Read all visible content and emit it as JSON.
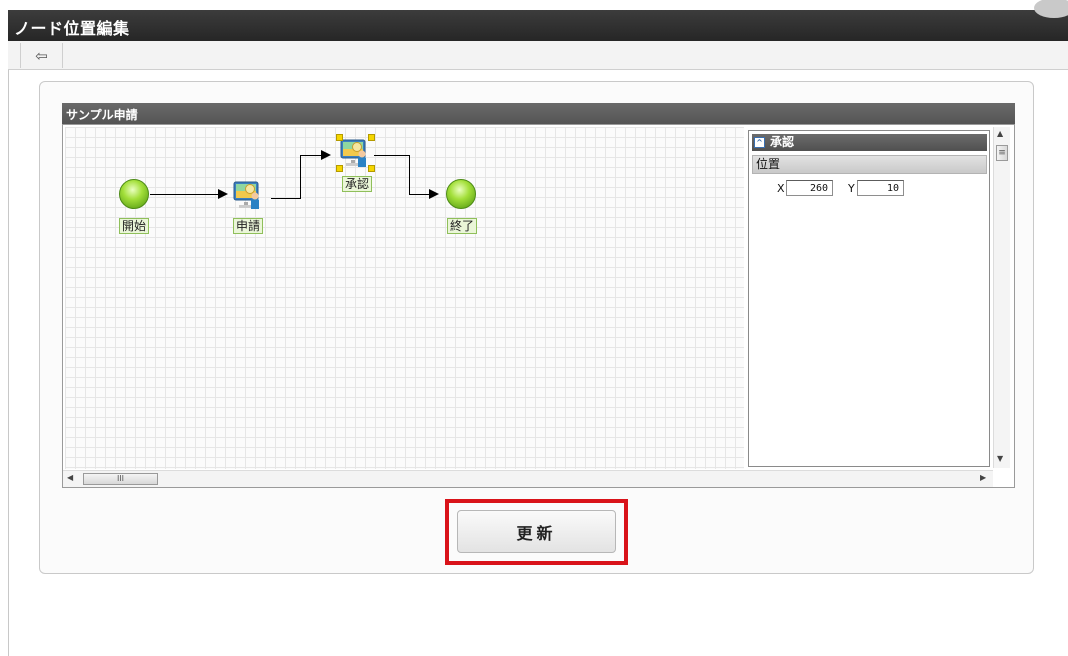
{
  "window": {
    "title": "ノード位置編集"
  },
  "toolbar": {
    "back_icon": "back-arrow-icon",
    "back_glyph": "⇦"
  },
  "flow": {
    "name": "サンプル申請",
    "nodes": {
      "start": "開始",
      "apply": "申請",
      "approve": "承認",
      "end": "終了"
    }
  },
  "properties": {
    "node_title": "承認",
    "collapse_glyph": "^",
    "section": "位置",
    "x_label": "X",
    "x_value": "260",
    "y_label": "Y",
    "y_value": "10"
  },
  "scrollbars": {
    "up": "▲",
    "down": "▼",
    "left": "◀",
    "right": "▶",
    "thumb_v": "≡",
    "thumb_h": "III"
  },
  "actions": {
    "update_label": "更新"
  },
  "colors": {
    "highlight": "#d9131a",
    "node_green": "#a3df3a",
    "handle": "#f5d600"
  }
}
